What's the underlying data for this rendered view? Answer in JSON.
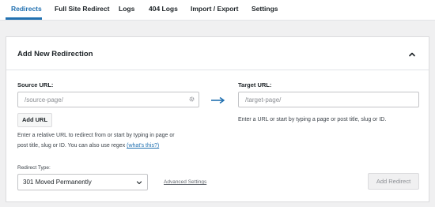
{
  "tabs": [
    {
      "label": "Redirects",
      "active": true
    },
    {
      "label": "Full Site Redirect"
    },
    {
      "label": "Logs"
    },
    {
      "label": "404 Logs"
    },
    {
      "label": "Import / Export"
    },
    {
      "label": "Settings"
    }
  ],
  "colors": {
    "accent": "#2271b1"
  },
  "panel": {
    "title": "Add New Redirection",
    "collapse_icon": "chevron-up-icon"
  },
  "source": {
    "label": "Source URL:",
    "placeholder": "/source-page/",
    "value": "",
    "settings_icon": "gear-icon",
    "add_url_label": "Add URL",
    "help_line1": "Enter a relative URL to redirect from or start by typing in page or",
    "help_line2": "post title, slug or ID. You can also use regex",
    "help_link": "(what's this?)"
  },
  "arrow_icon": "arrow-right-icon",
  "target": {
    "label": "Target URL:",
    "placeholder": "/target-page/",
    "value": "",
    "help": "Enter a URL or start by typing a page or post title, slug or ID."
  },
  "redirect_type": {
    "label": "Redirect Type:",
    "selected": "301 Moved Permanently"
  },
  "advanced_settings_label": "Advanced Settings",
  "add_redirect_label": "Add Redirect"
}
